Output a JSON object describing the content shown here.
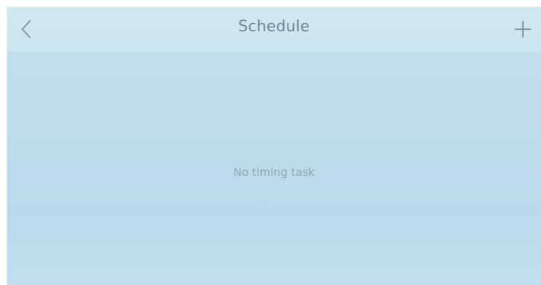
{
  "header": {
    "title": "Schedule",
    "back_icon": "chevron-left-icon",
    "add_icon": "plus-icon"
  },
  "main": {
    "empty_message": "No timing task"
  },
  "colors": {
    "background": "#c0dceb",
    "header_background": "#d0e7f1",
    "title_text": "#6f8896",
    "muted_text": "#8fa6b2"
  }
}
